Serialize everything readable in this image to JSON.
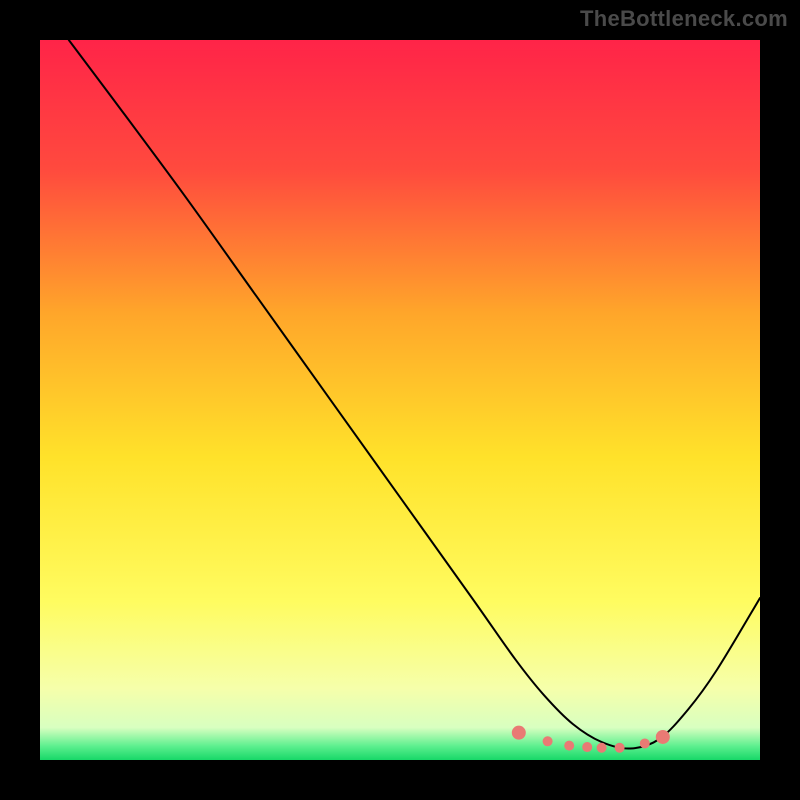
{
  "watermark": "TheBottleneck.com",
  "chart_data": {
    "type": "line",
    "title": "",
    "xlabel": "",
    "ylabel": "",
    "xlim": [
      0,
      100
    ],
    "ylim": [
      0,
      100
    ],
    "background_gradient_stops": [
      {
        "offset": 0.0,
        "color": "#ff2448"
      },
      {
        "offset": 0.18,
        "color": "#ff4a3e"
      },
      {
        "offset": 0.38,
        "color": "#ffa62a"
      },
      {
        "offset": 0.58,
        "color": "#ffe22a"
      },
      {
        "offset": 0.78,
        "color": "#fffc60"
      },
      {
        "offset": 0.9,
        "color": "#f6ffaa"
      },
      {
        "offset": 0.955,
        "color": "#d8ffc0"
      },
      {
        "offset": 0.98,
        "color": "#60f090"
      },
      {
        "offset": 1.0,
        "color": "#18d868"
      }
    ],
    "curve_color": "#000000",
    "curve_width": 2.0,
    "marker_color": "#e97a74",
    "marker_radius_small": 5,
    "marker_radius_large": 7,
    "series": [
      {
        "name": "bottleneck-curve",
        "x": [
          4,
          10,
          20,
          30,
          40,
          50,
          60,
          66,
          70,
          74,
          78,
          82,
          86,
          90,
          94,
          100
        ],
        "y": [
          100,
          92,
          78.5,
          64.5,
          50.5,
          36.5,
          22.5,
          14,
          9.0,
          5.0,
          2.5,
          1.6,
          2.9,
          7.0,
          12.5,
          22.5
        ]
      }
    ],
    "markers": {
      "x": [
        66.5,
        70.5,
        73.5,
        76.0,
        78.0,
        80.5,
        84.0,
        86.5
      ],
      "y": [
        3.8,
        2.6,
        2.0,
        1.8,
        1.7,
        1.7,
        2.3,
        3.2
      ],
      "large_indices": [
        0,
        7
      ]
    }
  }
}
